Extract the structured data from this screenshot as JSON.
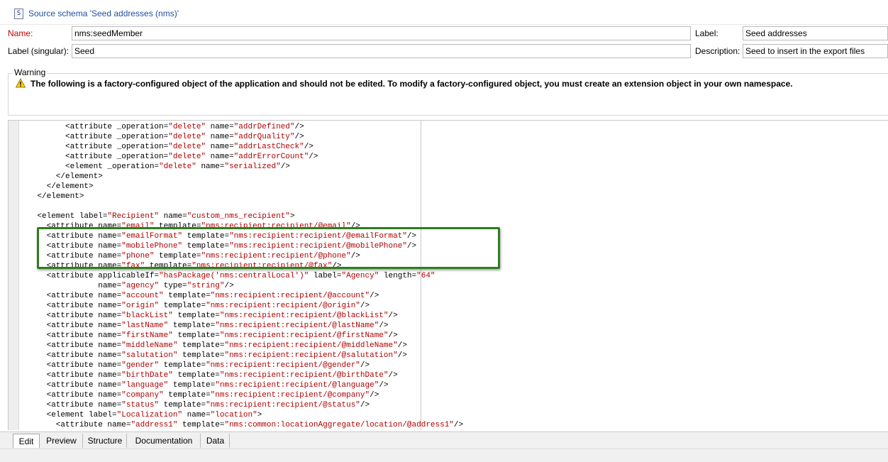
{
  "window": {
    "title": "Source schema 'Seed addresses (nms)'"
  },
  "form": {
    "name_label": "Name:",
    "name_value": "nms:seedMember",
    "label_label": "Label:",
    "label_value": "Seed addresses",
    "singular_label": "Label (singular):",
    "singular_value": "Seed",
    "description_label": "Description:",
    "description_value": "Seed to insert in the export files"
  },
  "warning": {
    "legend": "Warning",
    "message": "The following is a factory-configured object of the application and should not be edited. To modify a factory-configured object, you must create an extension object in your own namespace.",
    "icon": "warning-triangle-icon"
  },
  "editor": {
    "lines": [
      [
        [
          "t",
          "          <attribute "
        ],
        [
          "a",
          "_operation="
        ],
        [
          "v",
          "\"delete\""
        ],
        [
          "a",
          " name="
        ],
        [
          "v",
          "\"addrDefined\""
        ],
        [
          "t",
          "/>"
        ]
      ],
      [
        [
          "t",
          "          <attribute "
        ],
        [
          "a",
          "_operation="
        ],
        [
          "v",
          "\"delete\""
        ],
        [
          "a",
          " name="
        ],
        [
          "v",
          "\"addrQuality\""
        ],
        [
          "t",
          "/>"
        ]
      ],
      [
        [
          "t",
          "          <attribute "
        ],
        [
          "a",
          "_operation="
        ],
        [
          "v",
          "\"delete\""
        ],
        [
          "a",
          " name="
        ],
        [
          "v",
          "\"addrLastCheck\""
        ],
        [
          "t",
          "/>"
        ]
      ],
      [
        [
          "t",
          "          <attribute "
        ],
        [
          "a",
          "_operation="
        ],
        [
          "v",
          "\"delete\""
        ],
        [
          "a",
          " name="
        ],
        [
          "v",
          "\"addrErrorCount\""
        ],
        [
          "t",
          "/>"
        ]
      ],
      [
        [
          "t",
          "          <element "
        ],
        [
          "a",
          "_operation="
        ],
        [
          "v",
          "\"delete\""
        ],
        [
          "a",
          " name="
        ],
        [
          "v",
          "\"serialized\""
        ],
        [
          "t",
          "/>"
        ]
      ],
      [
        [
          "t",
          "        </element>"
        ]
      ],
      [
        [
          "t",
          "      </element>"
        ]
      ],
      [
        [
          "t",
          "    </element>"
        ]
      ],
      [
        [
          "t",
          ""
        ]
      ],
      [
        [
          "t",
          "    <element "
        ],
        [
          "a",
          "label="
        ],
        [
          "v",
          "\"Recipient\""
        ],
        [
          "a",
          " name="
        ],
        [
          "v",
          "\"custom_nms_recipient\""
        ],
        [
          "t",
          ">"
        ]
      ],
      [
        [
          "t",
          "      <attribute "
        ],
        [
          "a",
          "name="
        ],
        [
          "v",
          "\"email\""
        ],
        [
          "a",
          " template="
        ],
        [
          "v",
          "\"nms:recipient:recipient/@email\""
        ],
        [
          "t",
          "/>"
        ]
      ],
      [
        [
          "t",
          "      <attribute "
        ],
        [
          "a",
          "name="
        ],
        [
          "v",
          "\"emailFormat\""
        ],
        [
          "a",
          " template="
        ],
        [
          "v",
          "\"nms:recipient:recipient/@emailFormat\""
        ],
        [
          "t",
          "/>"
        ]
      ],
      [
        [
          "t",
          "      <attribute "
        ],
        [
          "a",
          "name="
        ],
        [
          "v",
          "\"mobilePhone\""
        ],
        [
          "a",
          " template="
        ],
        [
          "v",
          "\"nms:recipient:recipient/@mobilePhone\""
        ],
        [
          "t",
          "/>"
        ]
      ],
      [
        [
          "t",
          "      <attribute "
        ],
        [
          "a",
          "name="
        ],
        [
          "v",
          "\"phone\""
        ],
        [
          "a",
          " template="
        ],
        [
          "v",
          "\"nms:recipient:recipient/@phone\""
        ],
        [
          "t",
          "/>"
        ]
      ],
      [
        [
          "t",
          "      <attribute "
        ],
        [
          "a",
          "name="
        ],
        [
          "v",
          "\"fax\""
        ],
        [
          "a",
          " template="
        ],
        [
          "v",
          "\"nms:recipient:recipient/@fax\""
        ],
        [
          "t",
          "/>"
        ]
      ],
      [
        [
          "t",
          "      <attribute "
        ],
        [
          "a",
          "applicableIf="
        ],
        [
          "v",
          "\"hasPackage('nms:centralLocal')\""
        ],
        [
          "a",
          " label="
        ],
        [
          "v",
          "\"Agency\""
        ],
        [
          "a",
          " length="
        ],
        [
          "v",
          "\"64\""
        ]
      ],
      [
        [
          "t",
          "                 "
        ],
        [
          "a",
          "name="
        ],
        [
          "v",
          "\"agency\""
        ],
        [
          "a",
          " type="
        ],
        [
          "v",
          "\"string\""
        ],
        [
          "t",
          "/>"
        ]
      ],
      [
        [
          "t",
          "      <attribute "
        ],
        [
          "a",
          "name="
        ],
        [
          "v",
          "\"account\""
        ],
        [
          "a",
          " template="
        ],
        [
          "v",
          "\"nms:recipient:recipient/@account\""
        ],
        [
          "t",
          "/>"
        ]
      ],
      [
        [
          "t",
          "      <attribute "
        ],
        [
          "a",
          "name="
        ],
        [
          "v",
          "\"origin\""
        ],
        [
          "a",
          " template="
        ],
        [
          "v",
          "\"nms:recipient:recipient/@origin\""
        ],
        [
          "t",
          "/>"
        ]
      ],
      [
        [
          "t",
          "      <attribute "
        ],
        [
          "a",
          "name="
        ],
        [
          "v",
          "\"blackList\""
        ],
        [
          "a",
          " template="
        ],
        [
          "v",
          "\"nms:recipient:recipient/@blackList\""
        ],
        [
          "t",
          "/>"
        ]
      ],
      [
        [
          "t",
          "      <attribute "
        ],
        [
          "a",
          "name="
        ],
        [
          "v",
          "\"lastName\""
        ],
        [
          "a",
          " template="
        ],
        [
          "v",
          "\"nms:recipient:recipient/@lastName\""
        ],
        [
          "t",
          "/>"
        ]
      ],
      [
        [
          "t",
          "      <attribute "
        ],
        [
          "a",
          "name="
        ],
        [
          "v",
          "\"firstName\""
        ],
        [
          "a",
          " template="
        ],
        [
          "v",
          "\"nms:recipient:recipient/@firstName\""
        ],
        [
          "t",
          "/>"
        ]
      ],
      [
        [
          "t",
          "      <attribute "
        ],
        [
          "a",
          "name="
        ],
        [
          "v",
          "\"middleName\""
        ],
        [
          "a",
          " template="
        ],
        [
          "v",
          "\"nms:recipient:recipient/@middleName\""
        ],
        [
          "t",
          "/>"
        ]
      ],
      [
        [
          "t",
          "      <attribute "
        ],
        [
          "a",
          "name="
        ],
        [
          "v",
          "\"salutation\""
        ],
        [
          "a",
          " template="
        ],
        [
          "v",
          "\"nms:recipient:recipient/@salutation\""
        ],
        [
          "t",
          "/>"
        ]
      ],
      [
        [
          "t",
          "      <attribute "
        ],
        [
          "a",
          "name="
        ],
        [
          "v",
          "\"gender\""
        ],
        [
          "a",
          " template="
        ],
        [
          "v",
          "\"nms:recipient:recipient/@gender\""
        ],
        [
          "t",
          "/>"
        ]
      ],
      [
        [
          "t",
          "      <attribute "
        ],
        [
          "a",
          "name="
        ],
        [
          "v",
          "\"birthDate\""
        ],
        [
          "a",
          " template="
        ],
        [
          "v",
          "\"nms:recipient:recipient/@birthDate\""
        ],
        [
          "t",
          "/>"
        ]
      ],
      [
        [
          "t",
          "      <attribute "
        ],
        [
          "a",
          "name="
        ],
        [
          "v",
          "\"language\""
        ],
        [
          "a",
          " template="
        ],
        [
          "v",
          "\"nms:recipient:recipient/@language\""
        ],
        [
          "t",
          "/>"
        ]
      ],
      [
        [
          "t",
          "      <attribute "
        ],
        [
          "a",
          "name="
        ],
        [
          "v",
          "\"company\""
        ],
        [
          "a",
          " template="
        ],
        [
          "v",
          "\"nms:recipient:recipient/@company\""
        ],
        [
          "t",
          "/>"
        ]
      ],
      [
        [
          "t",
          "      <attribute "
        ],
        [
          "a",
          "name="
        ],
        [
          "v",
          "\"status\""
        ],
        [
          "a",
          " template="
        ],
        [
          "v",
          "\"nms:recipient:recipient/@status\""
        ],
        [
          "t",
          "/>"
        ]
      ],
      [
        [
          "t",
          "      <element "
        ],
        [
          "a",
          "label="
        ],
        [
          "v",
          "\"Localization\""
        ],
        [
          "a",
          " name="
        ],
        [
          "v",
          "\"location\""
        ],
        [
          "t",
          ">"
        ]
      ],
      [
        [
          "t",
          "        <attribute "
        ],
        [
          "a",
          "name="
        ],
        [
          "v",
          "\"address1\""
        ],
        [
          "a",
          " template="
        ],
        [
          "v",
          "\"nms:common:locationAggregate/location/@address1\""
        ],
        [
          "t",
          "/>"
        ]
      ]
    ]
  },
  "tabs": [
    {
      "label": "Edit",
      "active": true
    },
    {
      "label": "Preview",
      "active": false
    },
    {
      "label": "Structure",
      "active": false
    },
    {
      "label": "Documentation",
      "active": false
    },
    {
      "label": "Data",
      "active": false
    }
  ],
  "colors": {
    "title_text": "#1f4f9f",
    "label_red": "#c00000",
    "xml_value": "#b00000",
    "highlight_border": "#2f7d1e"
  }
}
